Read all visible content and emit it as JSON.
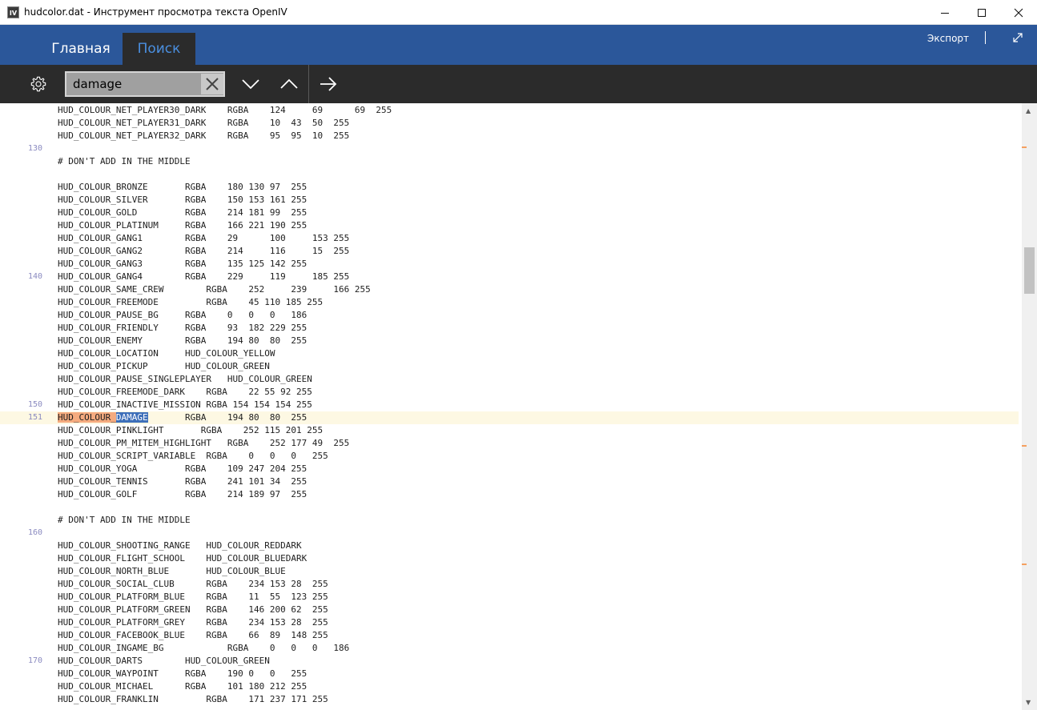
{
  "window": {
    "title": "hudcolor.dat - Инструмент просмотра текста OpenIV",
    "icon_text": "IV"
  },
  "ribbon": {
    "tabs": [
      {
        "label": "Главная",
        "active": false
      },
      {
        "label": "Поиск",
        "active": true
      }
    ],
    "export_label": "Экспорт"
  },
  "search": {
    "value": "damage"
  },
  "colors": {
    "ribbon": "#2b579a",
    "toolbar": "#2b2b2b",
    "active_tab_text": "#4a8fe0",
    "match_highlight": "#3d6fb9",
    "line_highlight": "#f5ab7f"
  },
  "editor": {
    "current_line": 151,
    "lines": [
      {
        "n": "",
        "t": "HUD_COLOUR_NET_PLAYER30_DARK    RGBA    124     69      69  255"
      },
      {
        "n": "",
        "t": "HUD_COLOUR_NET_PLAYER31_DARK    RGBA    10  43  50  255"
      },
      {
        "n": "",
        "t": "HUD_COLOUR_NET_PLAYER32_DARK    RGBA    95  95  10  255"
      },
      {
        "n": "130",
        "t": ""
      },
      {
        "n": "",
        "t": "# DON'T ADD IN THE MIDDLE"
      },
      {
        "n": "",
        "t": ""
      },
      {
        "n": "",
        "t": "HUD_COLOUR_BRONZE       RGBA    180 130 97  255"
      },
      {
        "n": "",
        "t": "HUD_COLOUR_SILVER       RGBA    150 153 161 255"
      },
      {
        "n": "",
        "t": "HUD_COLOUR_GOLD         RGBA    214 181 99  255"
      },
      {
        "n": "",
        "t": "HUD_COLOUR_PLATINUM     RGBA    166 221 190 255"
      },
      {
        "n": "",
        "t": "HUD_COLOUR_GANG1        RGBA    29      100     153 255"
      },
      {
        "n": "",
        "t": "HUD_COLOUR_GANG2        RGBA    214     116     15  255"
      },
      {
        "n": "",
        "t": "HUD_COLOUR_GANG3        RGBA    135 125 142 255"
      },
      {
        "n": "140",
        "t": "HUD_COLOUR_GANG4        RGBA    229     119     185 255"
      },
      {
        "n": "",
        "t": "HUD_COLOUR_SAME_CREW        RGBA    252     239     166 255"
      },
      {
        "n": "",
        "t": "HUD_COLOUR_FREEMODE         RGBA    45 110 185 255"
      },
      {
        "n": "",
        "t": "HUD_COLOUR_PAUSE_BG     RGBA    0   0   0   186"
      },
      {
        "n": "",
        "t": "HUD_COLOUR_FRIENDLY     RGBA    93  182 229 255"
      },
      {
        "n": "",
        "t": "HUD_COLOUR_ENEMY        RGBA    194 80  80  255"
      },
      {
        "n": "",
        "t": "HUD_COLOUR_LOCATION     HUD_COLOUR_YELLOW"
      },
      {
        "n": "",
        "t": "HUD_COLOUR_PICKUP       HUD_COLOUR_GREEN"
      },
      {
        "n": "",
        "t": "HUD_COLOUR_PAUSE_SINGLEPLAYER   HUD_COLOUR_GREEN"
      },
      {
        "n": "",
        "t": "HUD_COLOUR_FREEMODE_DARK    RGBA    22 55 92 255"
      },
      {
        "n": "150",
        "t": "HUD_COLOUR_INACTIVE_MISSION RGBA 154 154 154 255"
      },
      {
        "n": "151",
        "t": "HUD_COLOUR_DAMAGE       RGBA    194 80  80  255"
      },
      {
        "n": "",
        "t": "HUD_COLOUR_PINKLIGHT       RGBA    252 115 201 255"
      },
      {
        "n": "",
        "t": "HUD_COLOUR_PM_MITEM_HIGHLIGHT   RGBA    252 177 49  255"
      },
      {
        "n": "",
        "t": "HUD_COLOUR_SCRIPT_VARIABLE  RGBA    0   0   0   255"
      },
      {
        "n": "",
        "t": "HUD_COLOUR_YOGA         RGBA    109 247 204 255"
      },
      {
        "n": "",
        "t": "HUD_COLOUR_TENNIS       RGBA    241 101 34  255"
      },
      {
        "n": "",
        "t": "HUD_COLOUR_GOLF         RGBA    214 189 97  255"
      },
      {
        "n": "",
        "t": ""
      },
      {
        "n": "",
        "t": "# DON'T ADD IN THE MIDDLE"
      },
      {
        "n": "160",
        "t": ""
      },
      {
        "n": "",
        "t": "HUD_COLOUR_SHOOTING_RANGE   HUD_COLOUR_REDDARK"
      },
      {
        "n": "",
        "t": "HUD_COLOUR_FLIGHT_SCHOOL    HUD_COLOUR_BLUEDARK"
      },
      {
        "n": "",
        "t": "HUD_COLOUR_NORTH_BLUE       HUD_COLOUR_BLUE"
      },
      {
        "n": "",
        "t": "HUD_COLOUR_SOCIAL_CLUB      RGBA    234 153 28  255"
      },
      {
        "n": "",
        "t": "HUD_COLOUR_PLATFORM_BLUE    RGBA    11  55  123 255"
      },
      {
        "n": "",
        "t": "HUD_COLOUR_PLATFORM_GREEN   RGBA    146 200 62  255"
      },
      {
        "n": "",
        "t": "HUD_COLOUR_PLATFORM_GREY    RGBA    234 153 28  255"
      },
      {
        "n": "",
        "t": "HUD_COLOUR_FACEBOOK_BLUE    RGBA    66  89  148 255"
      },
      {
        "n": "",
        "t": "HUD_COLOUR_INGAME_BG            RGBA    0   0   0   186"
      },
      {
        "n": "170",
        "t": "HUD_COLOUR_DARTS        HUD_COLOUR_GREEN"
      },
      {
        "n": "",
        "t": "HUD_COLOUR_WAYPOINT     RGBA    190 0   0   255"
      },
      {
        "n": "",
        "t": "HUD_COLOUR_MICHAEL      RGBA    101 180 212 255"
      },
      {
        "n": "",
        "t": "HUD_COLOUR_FRANKLIN         RGBA    171 237 171 255"
      }
    ]
  }
}
